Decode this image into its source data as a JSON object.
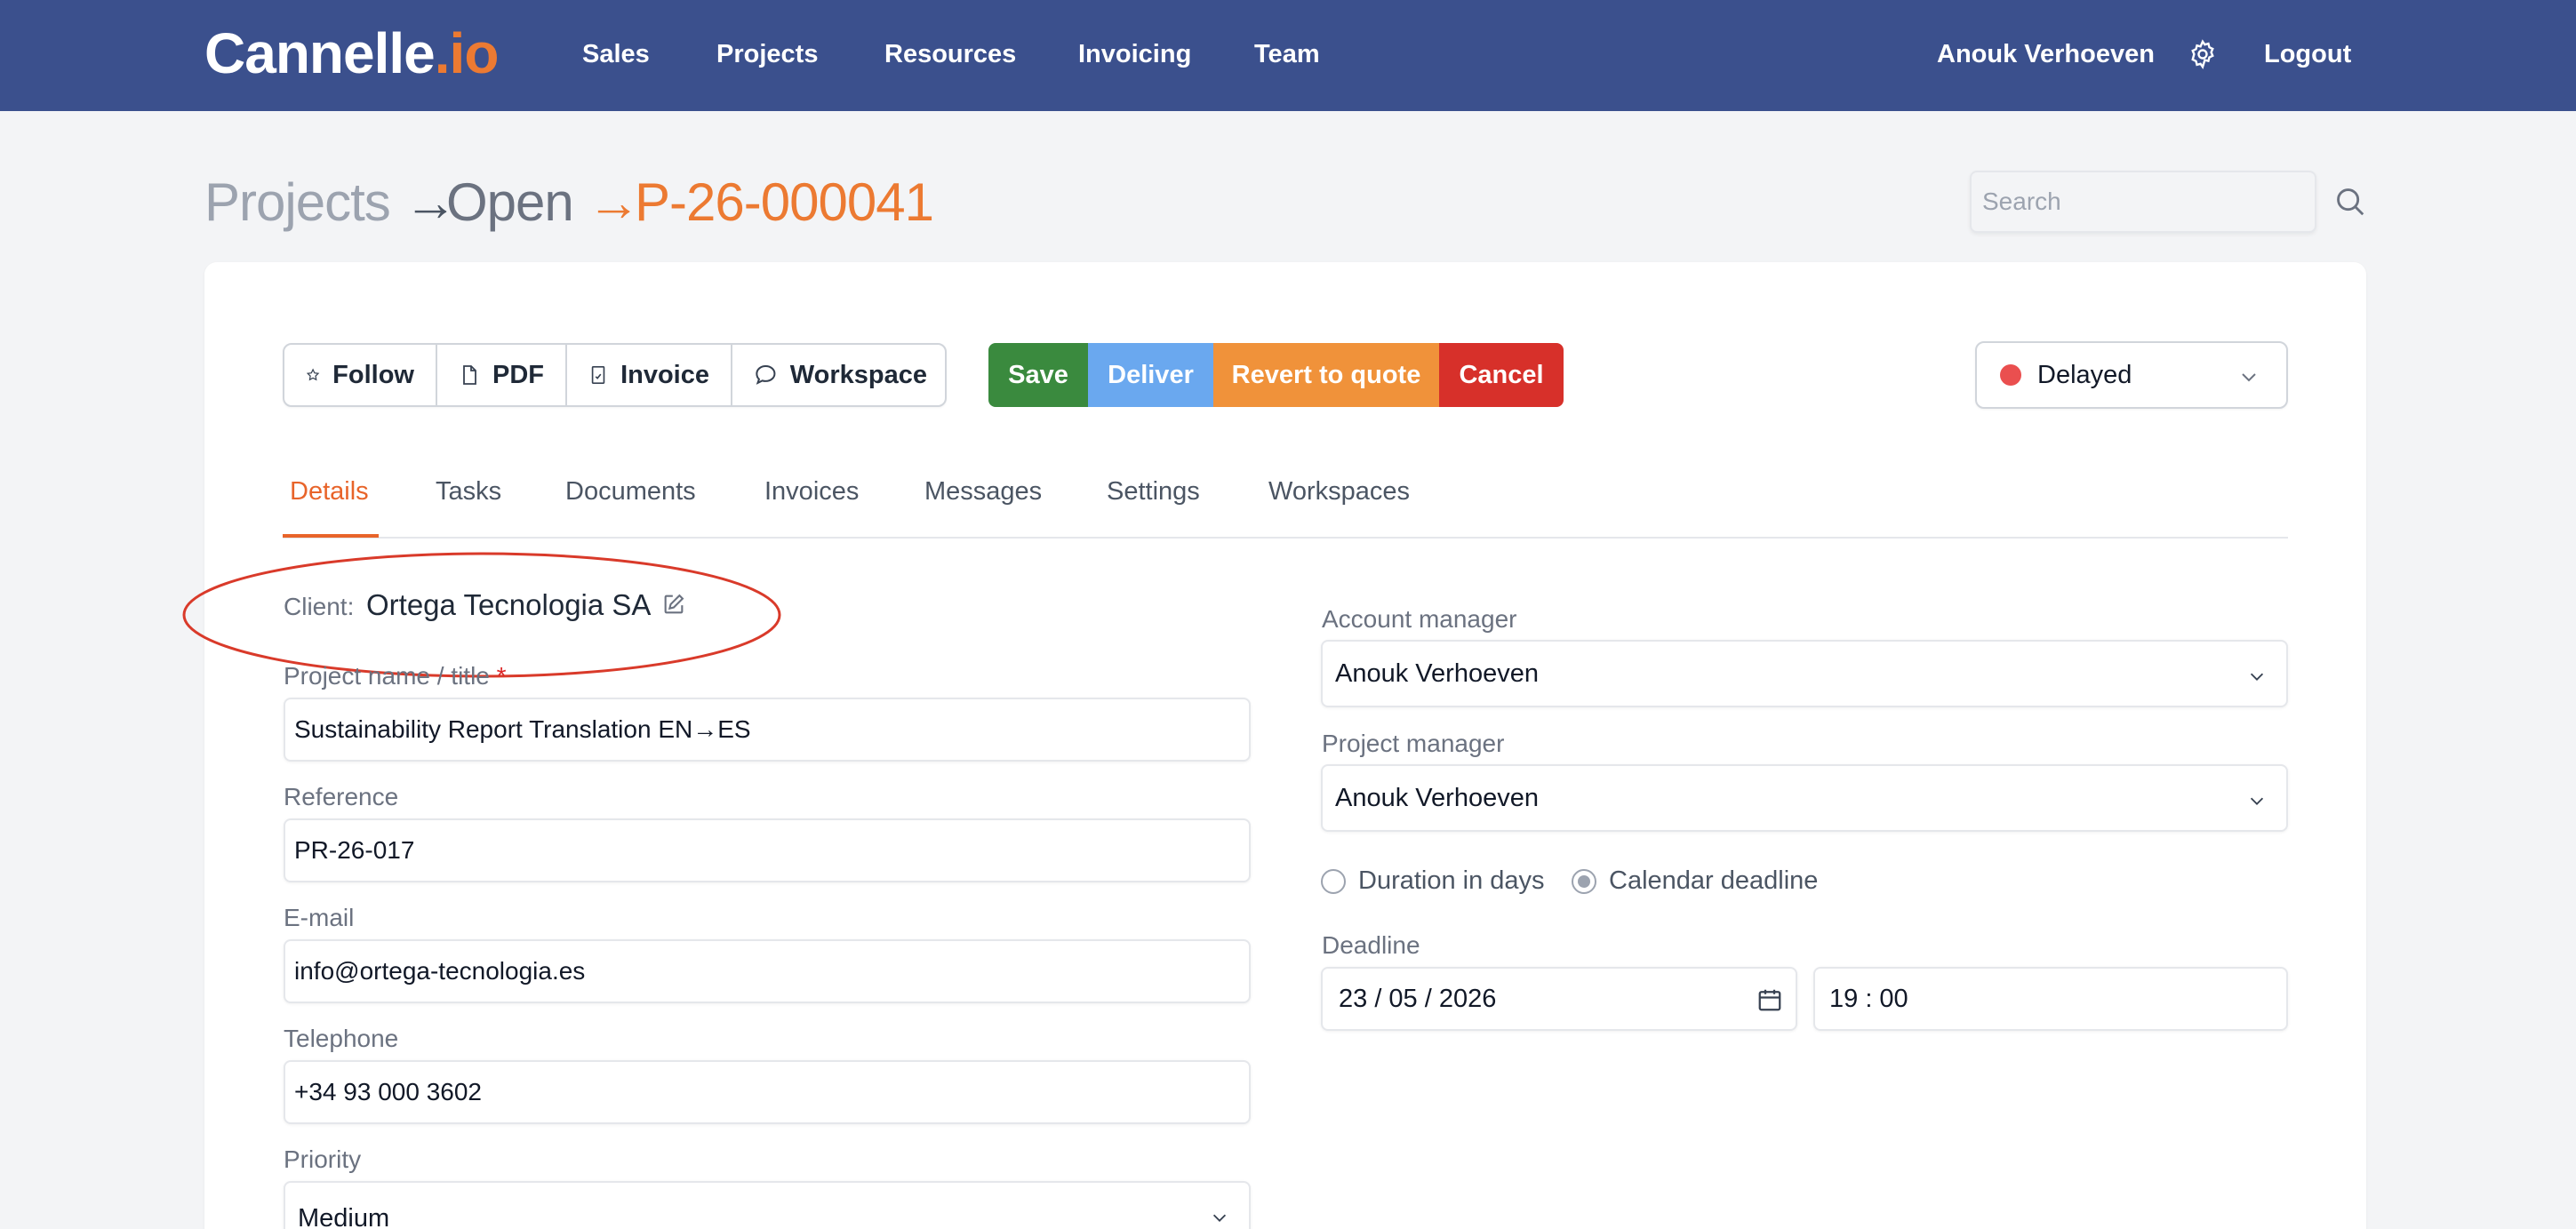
{
  "app": {
    "logo_main": "Cannelle",
    "logo_suffix": ".io"
  },
  "nav": {
    "items": [
      {
        "label": "Sales"
      },
      {
        "label": "Projects"
      },
      {
        "label": "Resources"
      },
      {
        "label": "Invoicing"
      },
      {
        "label": "Team"
      }
    ],
    "user_name": "Anouk Verhoeven",
    "settings_icon": "gear-icon",
    "logout_label": "Logout"
  },
  "breadcrumb": {
    "root": "Projects",
    "section": "Open",
    "current": "P-26-000041",
    "separator": "→"
  },
  "search": {
    "placeholder": "Search",
    "value": ""
  },
  "toolbar": {
    "follow_label": "Follow",
    "pdf_label": "PDF",
    "invoice_label": "Invoice",
    "workspace_label": "Workspace",
    "save_label": "Save",
    "deliver_label": "Deliver",
    "revert_label": "Revert to quote",
    "cancel_label": "Cancel"
  },
  "status": {
    "value": "Delayed",
    "dot_color": "#ea4f4f"
  },
  "tabs": [
    {
      "label": "Details",
      "active": true
    },
    {
      "label": "Tasks"
    },
    {
      "label": "Documents"
    },
    {
      "label": "Invoices"
    },
    {
      "label": "Messages"
    },
    {
      "label": "Settings"
    },
    {
      "label": "Workspaces"
    }
  ],
  "client": {
    "label": "Client:",
    "name": "Ortega Tecnologia SA"
  },
  "form": {
    "project_name": {
      "label": "Project name / title",
      "required_mark": "*",
      "value": "Sustainability Report Translation EN→ES"
    },
    "reference": {
      "label": "Reference",
      "value": "PR-26-017"
    },
    "email": {
      "label": "E-mail",
      "value": "info@ortega-tecnologia.es"
    },
    "telephone": {
      "label": "Telephone",
      "value": "+34 93 000 3602"
    },
    "priority": {
      "label": "Priority",
      "value": "Medium"
    },
    "account_manager": {
      "label": "Account manager",
      "value": "Anouk Verhoeven"
    },
    "project_manager": {
      "label": "Project manager",
      "value": "Anouk Verhoeven"
    },
    "duration_option": "Duration in days",
    "deadline_option": "Calendar deadline",
    "deadline": {
      "label": "Deadline",
      "date": "23 / 05 / 2026",
      "time": "19 : 00"
    }
  },
  "colors": {
    "nav_bg": "#3b508d",
    "accent": "#ec7a32",
    "save": "#3a8a3e",
    "deliver": "#6aa8ef",
    "revert": "#f0923a",
    "cancel": "#d7302a",
    "annotation": "#d93a2a"
  }
}
